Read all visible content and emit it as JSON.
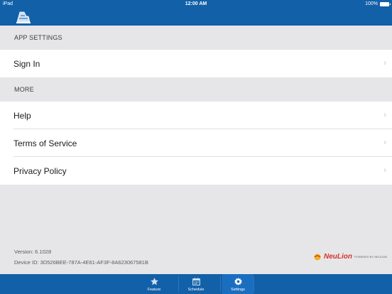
{
  "status_bar": {
    "time": "12:00 AM",
    "battery": "100%",
    "carrier": "iPad"
  },
  "sections": {
    "app_settings": {
      "title": "APP SETTINGS"
    },
    "more": {
      "title": "MORE"
    }
  },
  "rows": {
    "sign_in": "Sign In",
    "help": "Help",
    "terms": "Terms of Service",
    "privacy": "Privacy Policy"
  },
  "chevron": "›",
  "footer": {
    "version": "Version: 6.1028",
    "device_id": "Device ID: 3D526BEE-787A-4E61-AF3F-8A623067581B",
    "brand": "NeuLion",
    "brand_sub": "POWERED BY NEULION"
  },
  "tabs": [
    {
      "label": "Feature",
      "icon": "star-icon"
    },
    {
      "label": "Schedule",
      "icon": "calendar-icon"
    },
    {
      "label": "Settings",
      "icon": "gear-icon"
    }
  ],
  "colors": {
    "nav": "#1260a8",
    "background": "#e6e6e9",
    "brand": "#d8322a"
  }
}
